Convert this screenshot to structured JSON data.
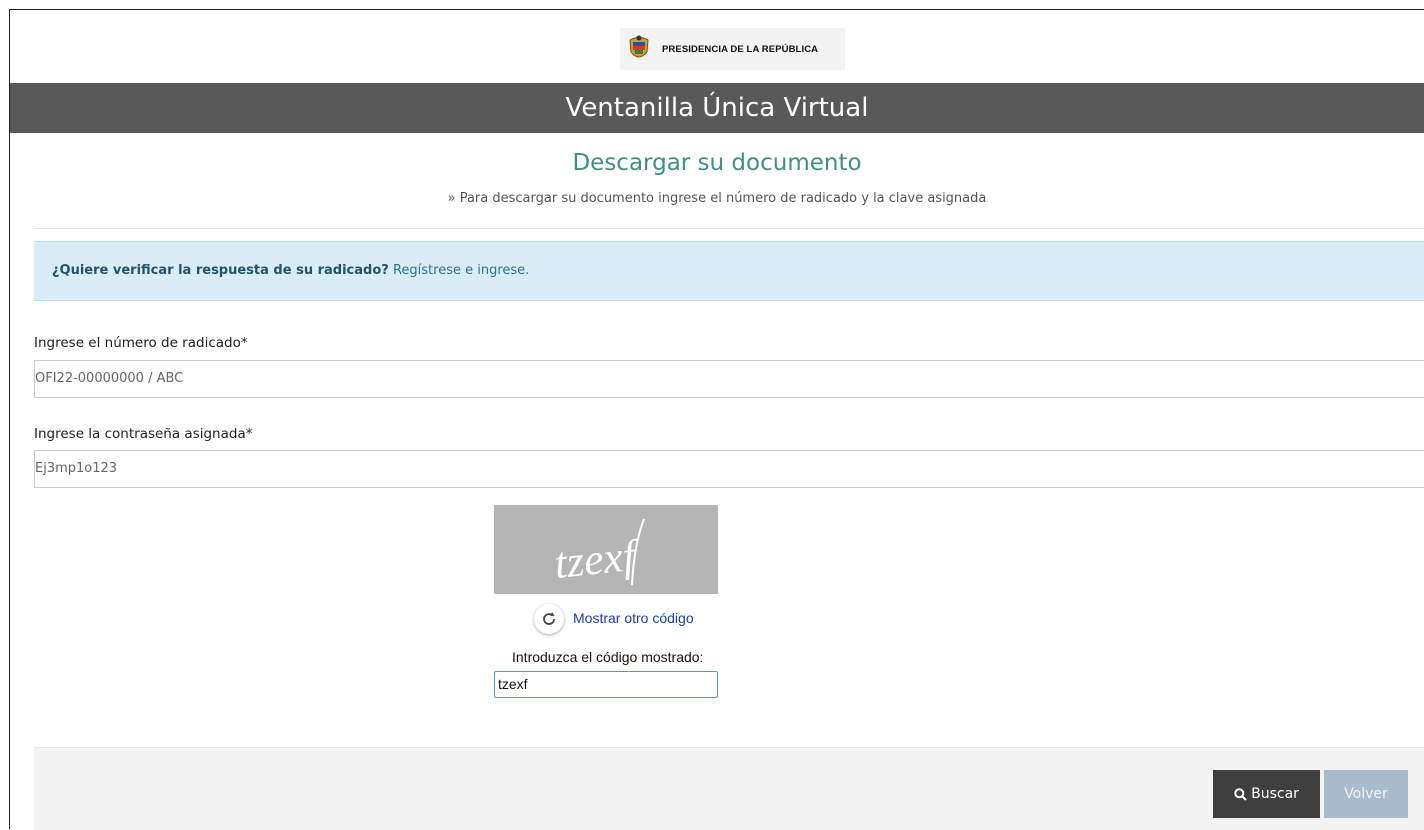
{
  "header": {
    "logo_text": "PRESIDENCIA DE LA REPÚBLICA",
    "app_title": "Ventanilla Única Virtual"
  },
  "page": {
    "title": "Descargar su documento",
    "subtitle": "» Para descargar su documento ingrese el número de radicado y la clave asignada"
  },
  "alert": {
    "question": "¿Quiere verificar la respuesta de su radicado?",
    "link": "Regístrese e ingrese."
  },
  "form": {
    "radicado_label": "Ingrese el número de radicado*",
    "radicado_placeholder": "OFI22-00000000 / ABC",
    "password_label": "Ingrese la contraseña asignada*",
    "password_placeholder": "Ej3mp1o123"
  },
  "captcha": {
    "image_text": "tzexf",
    "refresh_label": "Mostrar otro código",
    "input_label": "Introduzca el código mostrado:",
    "input_value": "tzexf"
  },
  "actions": {
    "search_label": "Buscar",
    "back_label": "Volver"
  },
  "colors": {
    "header_band": "#595959",
    "title_teal": "#3f8f88",
    "alert_bg": "#d9edf7",
    "search_button": "#3f3f3f",
    "back_button": "#a9bccd"
  },
  "icons": {
    "logo": "coat-of-arms-icon",
    "refresh": "refresh-icon",
    "search": "search-icon"
  }
}
